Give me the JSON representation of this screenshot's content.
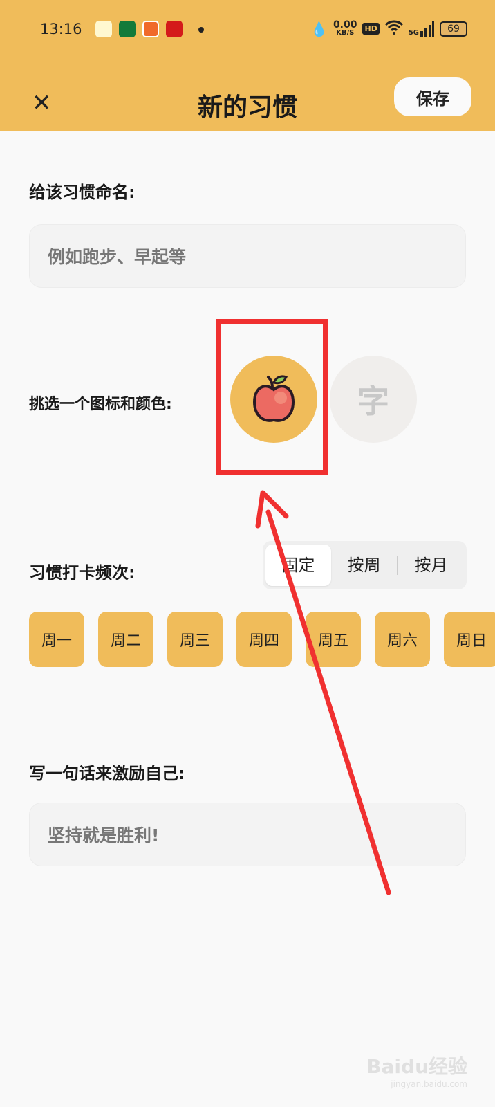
{
  "status_bar": {
    "time": "13:16",
    "net_speed": "0.00",
    "net_unit": "KB/S",
    "hd": "HD",
    "signal": "5G",
    "battery": "69"
  },
  "header": {
    "title": "新的习惯",
    "save_label": "保存",
    "close_icon": "close-icon"
  },
  "name_section": {
    "label": "给该习惯命名:",
    "placeholder": "例如跑步、早起等"
  },
  "icon_section": {
    "label": "挑选一个图标和颜色:",
    "selected_icon": "apple-icon",
    "selected_color": "#f0bc5a",
    "text_option": "字"
  },
  "frequency": {
    "label": "习惯打卡频次:",
    "tabs": [
      "固定",
      "按周",
      "按月"
    ],
    "active_tab": "固定",
    "days": [
      "周一",
      "周二",
      "周三",
      "周四",
      "周五",
      "周六",
      "周日"
    ]
  },
  "motto": {
    "label": "写一句话来激励自己:",
    "value": "坚持就是胜利!"
  },
  "annotation": {
    "color": "#f03030"
  },
  "watermark": {
    "text": "Baidu经验",
    "url": "jingyan.baidu.com"
  }
}
